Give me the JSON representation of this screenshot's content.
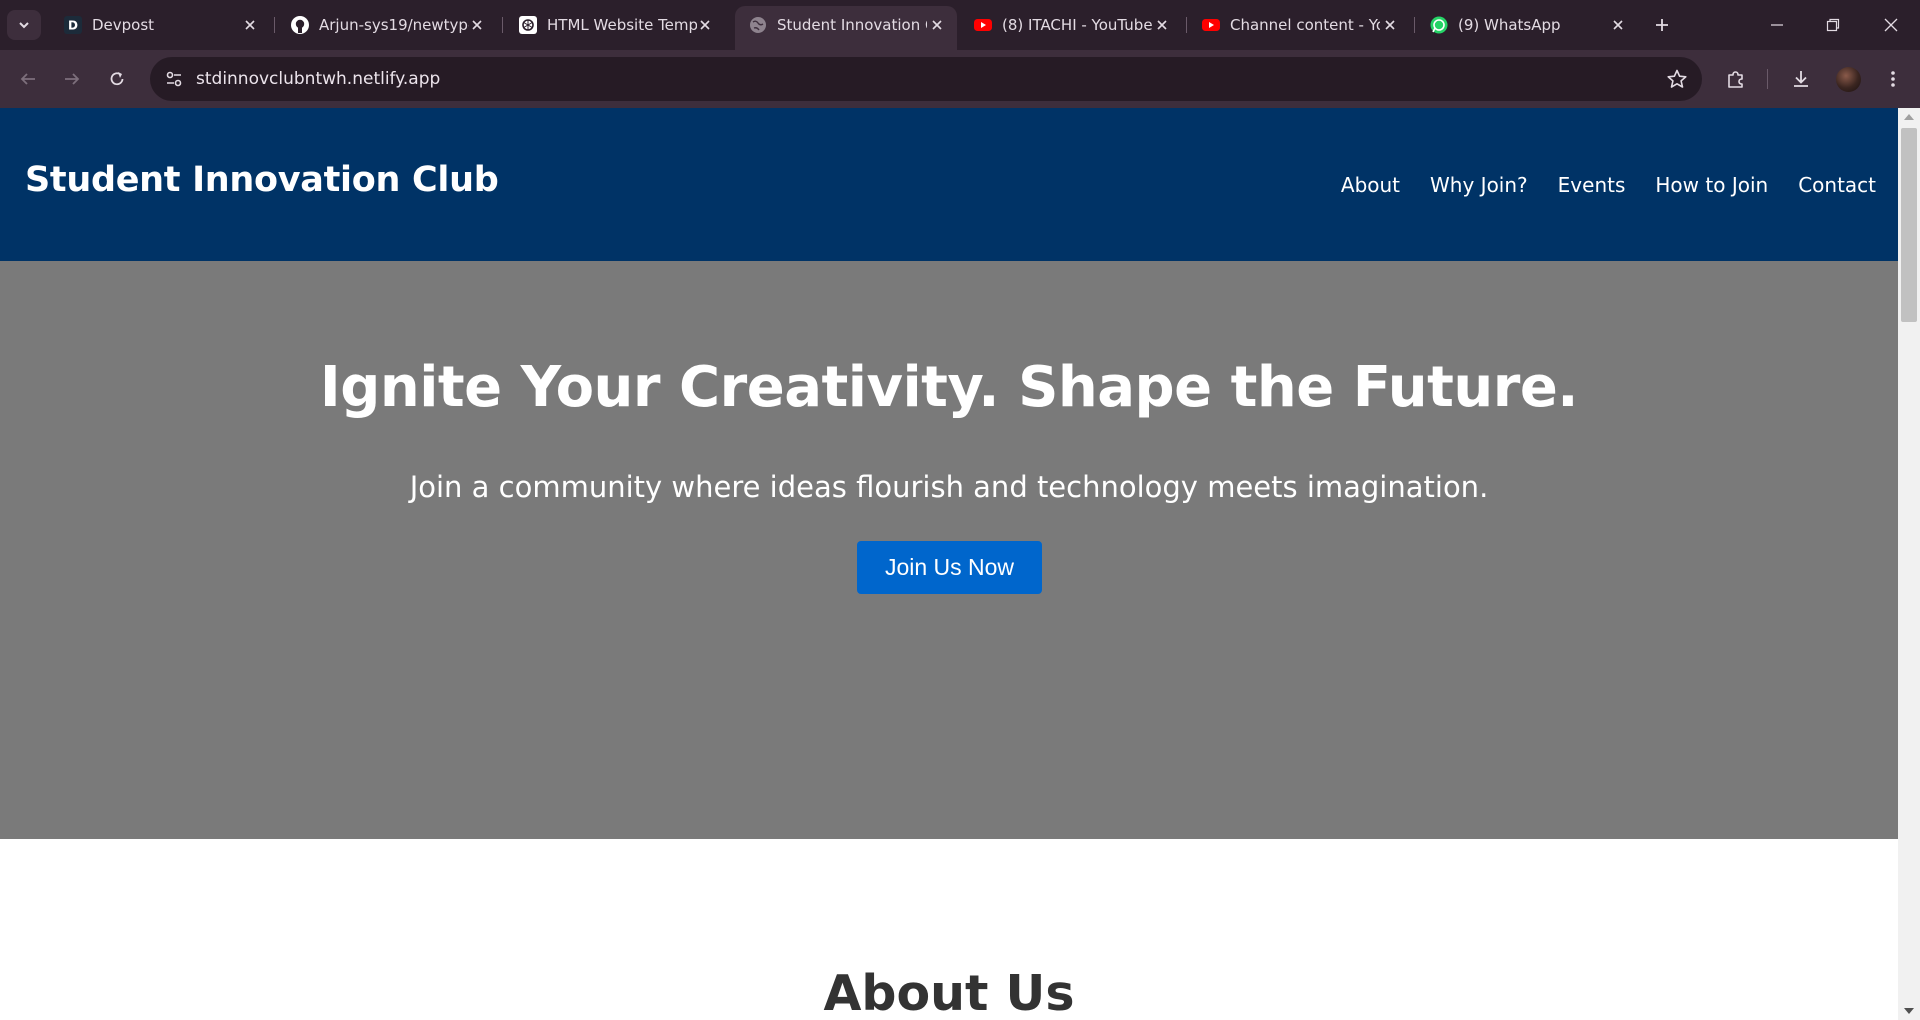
{
  "browser": {
    "tabs": [
      {
        "title": "Devpost",
        "icon": "devpost-icon",
        "active": false
      },
      {
        "title": "Arjun-sys19/newtype",
        "icon": "github-icon",
        "active": false
      },
      {
        "title": "HTML Website Templ",
        "icon": "openai-icon",
        "active": false
      },
      {
        "title": "Student Innovation C",
        "icon": "globe-icon",
        "active": true
      },
      {
        "title": "(8) ITACHI - YouTube",
        "icon": "youtube-icon",
        "active": false
      },
      {
        "title": "Channel content - Yo",
        "icon": "youtube-icon",
        "active": false
      },
      {
        "title": "(9) WhatsApp",
        "icon": "whatsapp-icon",
        "active": false
      }
    ],
    "url": "stdinnovclubntwh.netlify.app",
    "colors": {
      "tabstrip": "#2b1f2b",
      "toolbar": "#3d2e3c",
      "omnibox": "#261b25"
    }
  },
  "site": {
    "brand": "Student Innovation Club",
    "nav": [
      "About",
      "Why Join?",
      "Events",
      "How to Join",
      "Contact"
    ],
    "hero": {
      "heading": "Ignite Your Creativity. Shape the Future.",
      "subheading": "Join a community where ideas flourish and technology meets imagination.",
      "cta": "Join Us Now"
    },
    "about": {
      "title": "About Us"
    },
    "colors": {
      "header": "#003366",
      "hero": "#7a7a7a",
      "cta": "#0066cc",
      "about_title": "#333333"
    }
  }
}
